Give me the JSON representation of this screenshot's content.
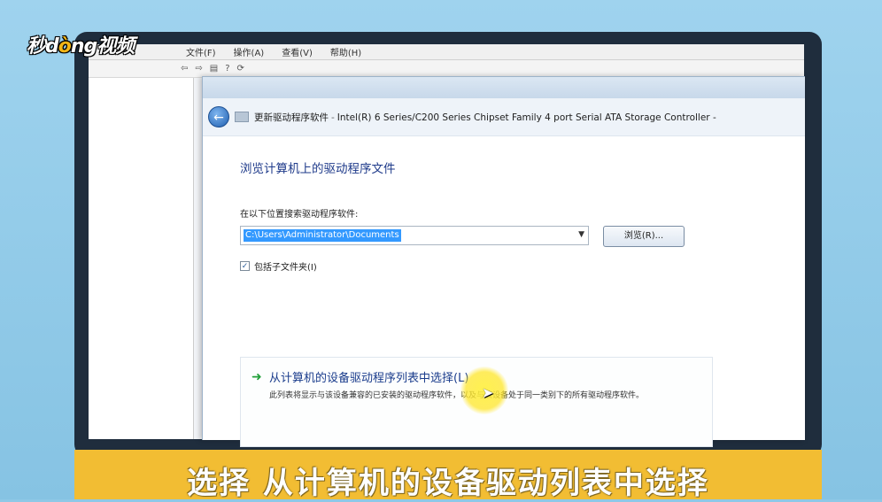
{
  "brand": {
    "logo_text_1": "秒d",
    "logo_dot": "ò",
    "logo_text_2": "ng视频"
  },
  "background_window": {
    "menu": [
      "文件(F)",
      "操作(A)",
      "查看(V)",
      "帮助(H)"
    ]
  },
  "dialog": {
    "breadcrumb_title": "更新驱动程序软件",
    "breadcrumb_device": "Intel(R) 6 Series/C200 Series Chipset Family 4 port Serial ATA Storage Controller -",
    "heading": "浏览计算机上的驱动程序文件",
    "search_label": "在以下位置搜索驱动程序软件:",
    "path_value": "C:\\Users\\Administrator\\Documents",
    "browse_label": "浏览(R)...",
    "include_subfolders_label": "包括子文件夹(I)",
    "include_subfolders_checked": true,
    "option": {
      "title": "从计算机的设备驱动程序列表中选择(L)",
      "description": "此列表将显示与该设备兼容的已安装的驱动程序软件，以及与该设备处于同一类别下的所有驱动程序软件。"
    }
  },
  "subtitle": "选择 从计算机的设备驱动列表中选择",
  "colors": {
    "subtitle_bar": "#f2bd33",
    "heading": "#1e3a8a",
    "selection": "#3399ff"
  }
}
